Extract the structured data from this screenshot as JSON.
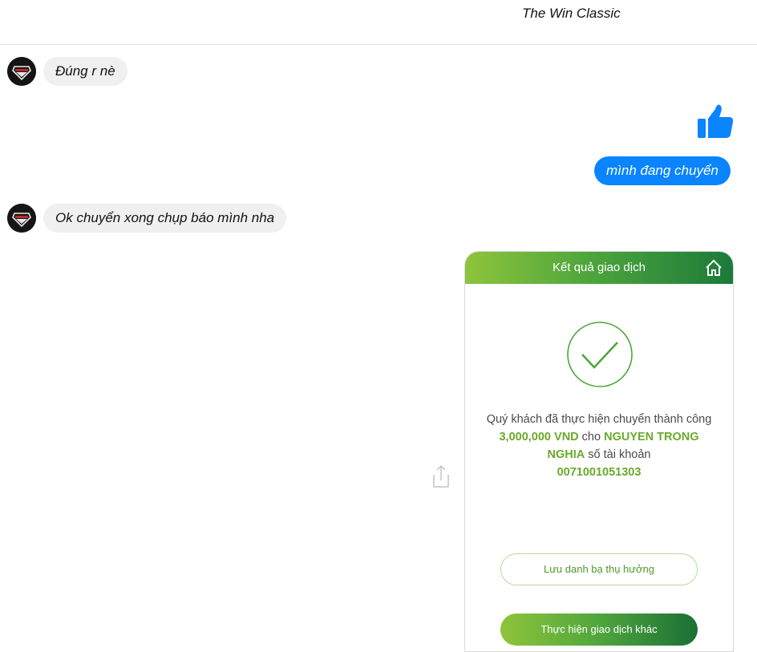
{
  "header": {
    "title": "The Win Classic"
  },
  "messages": {
    "incoming_1": "Đúng r nè",
    "outgoing_1": "mình đang chuyển",
    "incoming_2": "Ok chuyển xong chụp báo mình nha"
  },
  "transaction_card": {
    "title": "Kết quả giao dịch",
    "message_prefix": "Quý khách đã thực hiện chuyển thành công",
    "amount": "3,000,000 VND",
    "message_mid": "cho",
    "recipient": "NGUYEN TRONG NGHIA",
    "message_account_label": "số tài khoản",
    "account_number": "0071001051303",
    "save_button": "Lưu danh bạ thụ hưởng",
    "new_transaction_button": "Thực hiện giao dịch khác"
  },
  "colors": {
    "outgoing_bubble": "#0a84ff",
    "incoming_bubble": "#f0f0f0",
    "bank_green": "#4fa63c",
    "highlight_green": "#6aaa2a"
  },
  "icons": {
    "like": "thumbs-up-icon",
    "share": "share-icon",
    "home": "home-icon",
    "success": "check-circle-icon"
  }
}
